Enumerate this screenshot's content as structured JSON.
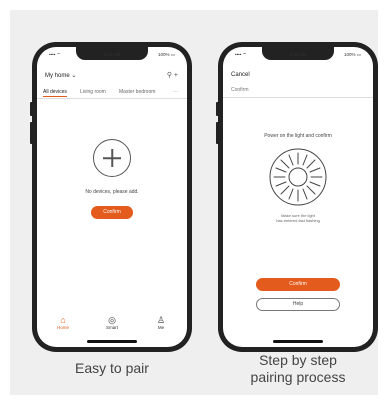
{
  "left_phone": {
    "status": {
      "signal": "•••• ⌔",
      "time": "9:41 AM",
      "battery": "100% ▭"
    },
    "header_title": "My home ⌄",
    "header_icons": "⚲  +",
    "tabs": [
      {
        "label": "All devices"
      },
      {
        "label": "Living room"
      },
      {
        "label": "Master bedroom"
      },
      {
        "label": "⋯"
      }
    ],
    "empty_text": "No devices, please add.",
    "confirm_label": "Confirm",
    "nav": [
      {
        "label": "Home",
        "icon": "home-icon",
        "glyph": "⌂"
      },
      {
        "label": "Smart",
        "icon": "smart-icon",
        "glyph": "◎"
      },
      {
        "label": "Me",
        "icon": "person-icon",
        "glyph": "♙"
      }
    ]
  },
  "right_phone": {
    "status": {
      "signal": "•••• ⌔",
      "time": "9:41 AM",
      "battery": "100% ▭"
    },
    "title": "Cancel",
    "subtitle": "Confirm",
    "instruction": "Power on the light and confirm",
    "hint_line1": "Make sure the light",
    "hint_line2": "has entered fast flashing",
    "confirm_label": "Confirm",
    "help_label": "Help"
  },
  "captions": {
    "left": "Easy to pair",
    "right_line1": "Step by step",
    "right_line2": "pairing process"
  },
  "colors": {
    "accent": "#e35b1d",
    "panel": "#efefef",
    "phone": "#222222"
  }
}
